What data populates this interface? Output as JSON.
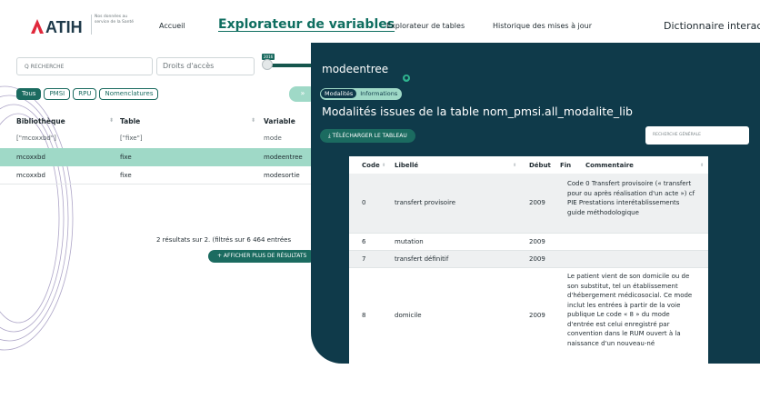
{
  "nav": {
    "logo_text": "ATIH",
    "logo_sub": "Nos données au service de la Santé",
    "accueil": "Accueil",
    "explorateur_variables": "Explorateur de variables",
    "explorateur_tables": "Explorateur de tables",
    "historique": "Historique des mises à jour",
    "dictionnaire": "Dictionnaire interactif"
  },
  "filters": {
    "search_placeholder": "RECHERCHE",
    "rights_placeholder": "Droits d'accès",
    "year_badge": "2016",
    "chips": [
      "Tous",
      "PMSI",
      "RPU",
      "Nomenclatures"
    ],
    "collapse_label": "»"
  },
  "vars_table": {
    "headers": [
      "Bibliothèque",
      "Table",
      "Variable"
    ],
    "filter_row": [
      "[\"mcoxxbd\"]",
      "[\"fixe\"]",
      "mode"
    ],
    "rows": [
      [
        "mcoxxbd",
        "fixe",
        "modeentree"
      ],
      [
        "mcoxxbd",
        "fixe",
        "modesortie"
      ]
    ],
    "results_text": "2 résultats sur 2. (filtrés sur 6 464 entrées",
    "more_button": "+ AFFICHER PLUS DE RÉSULTATS"
  },
  "panel": {
    "variable_name": "modeentree",
    "tabs": [
      "Modalités",
      "Informations"
    ],
    "section_title": "Modalités issues de la table nom_pmsi.all_modalite_lib",
    "download_button": "⤓ TÉLÉCHARGER LE TABLEAU",
    "global_search_placeholder": "RECHERCHE GÉNÉRALE",
    "columns": [
      "Code",
      "Libellé",
      "Début",
      "Fin",
      "Commentaire"
    ],
    "rows": [
      {
        "code": "0",
        "libelle": "transfert provisoire",
        "debut": "2009",
        "fin": "",
        "commentaire": "Code 0 Transfert provisoire (« transfert pour ou après réalisation d'un acte ») cf PIE Prestations interétablissements guide méthodologique"
      },
      {
        "code": "6",
        "libelle": "mutation",
        "debut": "2009",
        "fin": "",
        "commentaire": ""
      },
      {
        "code": "7",
        "libelle": "transfert définitif",
        "debut": "2009",
        "fin": "",
        "commentaire": ""
      },
      {
        "code": "8",
        "libelle": "domicile",
        "debut": "2009",
        "fin": "",
        "commentaire": "Le patient vient de son domicile ou de son substitut, tel un établissement d'hébergement médicosocial. Ce mode inclut les entrées à partir de la voie publique Le code « 8 » du mode d'entrée est celui enregistré par convention dans le RUM ouvert à la naissance d'un nouveau-né"
      }
    ]
  },
  "colors": {
    "panel_bg": "#0f3a4a",
    "accent": "#1b6b60",
    "mint": "#9fd9c7",
    "logo_red": "#e0283b"
  }
}
